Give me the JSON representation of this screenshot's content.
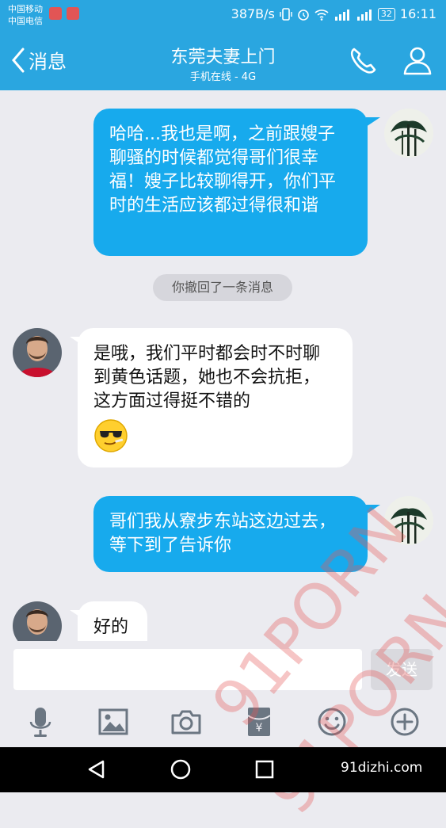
{
  "status_bar": {
    "carrier_1": "中国移动",
    "carrier_2": "中国电信",
    "net_speed": "387B/s",
    "battery": "32",
    "time": "16:11"
  },
  "header": {
    "back_label": "消息",
    "title": "东莞夫妻上门",
    "subtitle": "手机在线 - 4G"
  },
  "messages": [
    {
      "side": "out",
      "text": "哈哈...我也是啊，之前跟嫂子聊骚的时候都觉得哥们很幸福！嫂子比较聊得开，你们平时的生活应该都过得很和谐"
    },
    {
      "side": "system",
      "text": "你撤回了一条消息"
    },
    {
      "side": "in",
      "text": "是哦，我们平时都会时不时聊到黄色话题，她也不会抗拒，这方面过得挺不错的",
      "emoji": "cool-sunglasses-emoji"
    },
    {
      "side": "out",
      "text": "哥们我从寮步东站这边过去，等下到了告诉你"
    },
    {
      "side": "in",
      "text": "好的"
    }
  ],
  "input": {
    "send_label": "发送"
  },
  "toolbar_icons": [
    "microphone-icon",
    "image-icon",
    "camera-icon",
    "red-packet-icon",
    "emoji-icon",
    "plus-icon"
  ],
  "watermark": {
    "text_1": "91PORN",
    "text_2": "91PORN",
    "site": "91dizhi.com"
  },
  "colors": {
    "header_blue": "#2aa6e0",
    "bubble_blue": "#17aaed",
    "chat_bg": "#ebebf0"
  }
}
